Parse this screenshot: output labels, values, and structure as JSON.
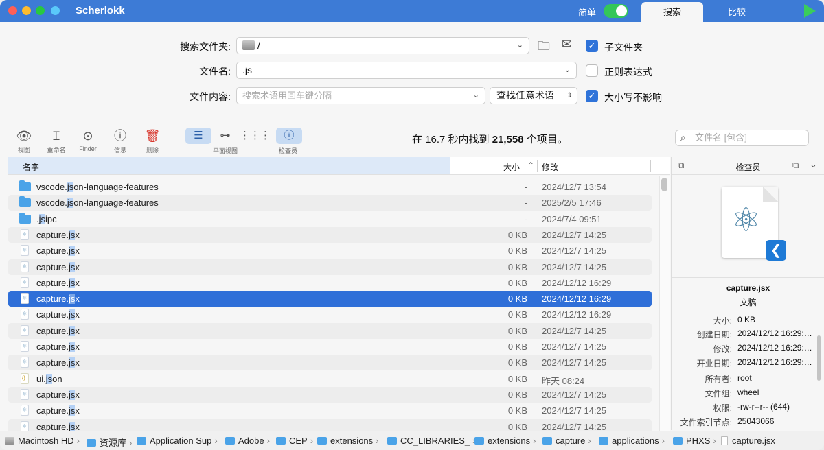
{
  "app": {
    "title": "Scherlokk"
  },
  "titlebar": {
    "simple_label": "简单",
    "tabs": [
      "搜索",
      "比较"
    ]
  },
  "form": {
    "folder_label": "搜索文件夹:",
    "folder_value": "/",
    "name_label": "文件名:",
    "name_value": ".js",
    "content_label": "文件内容:",
    "content_placeholder": "搜索术语用回车键分隔",
    "match_mode": "查找任意术语",
    "subfolders_label": "子文件夹",
    "subfolders_checked": true,
    "regex_label": "正则表达式",
    "regex_checked": false,
    "case_label": "大小写不影响",
    "case_checked": true
  },
  "toolbar": {
    "buttons": [
      {
        "label": "视图",
        "icon": "eye-icon"
      },
      {
        "label": "重命名",
        "icon": "rename-icon"
      },
      {
        "label": "Finder",
        "icon": "location-pin-icon"
      },
      {
        "label": "信息",
        "icon": "info-icon"
      },
      {
        "label": "删除",
        "icon": "trash-icon"
      }
    ],
    "flat_view_label": "平面视图",
    "inspector_label": "检查员",
    "status_prefix": "在 16.7 秒内找到 ",
    "status_count": "21,558",
    "status_suffix": " 个项目。",
    "search_placeholder": "文件名 [包含]"
  },
  "table": {
    "columns": {
      "name": "名字",
      "size": "大小",
      "modified": "修改"
    },
    "rows": [
      {
        "icon": "folder",
        "pre": "vscode.",
        "hl": "js",
        "post": "on-language-features",
        "size": "-",
        "date": "2024/12/7 13:54"
      },
      {
        "icon": "folder",
        "pre": "vscode.",
        "hl": "js",
        "post": "on-language-features",
        "size": "-",
        "date": "2025/2/5 17:46"
      },
      {
        "icon": "folder",
        "pre": ".",
        "hl": "js",
        "post": "ipc",
        "size": "-",
        "date": "2024/7/4 09:51"
      },
      {
        "icon": "file",
        "pre": "capture.",
        "hl": "js",
        "post": "x",
        "size": "0 KB",
        "date": "2024/12/7 14:25"
      },
      {
        "icon": "file",
        "pre": "capture.",
        "hl": "js",
        "post": "x",
        "size": "0 KB",
        "date": "2024/12/7 14:25"
      },
      {
        "icon": "file",
        "pre": "capture.",
        "hl": "js",
        "post": "x",
        "size": "0 KB",
        "date": "2024/12/7 14:25"
      },
      {
        "icon": "file",
        "pre": "capture.",
        "hl": "js",
        "post": "x",
        "size": "0 KB",
        "date": "2024/12/12 16:29"
      },
      {
        "icon": "file",
        "pre": "capture.",
        "hl": "js",
        "post": "x",
        "size": "0 KB",
        "date": "2024/12/12 16:29",
        "selected": true
      },
      {
        "icon": "file",
        "pre": "capture.",
        "hl": "js",
        "post": "x",
        "size": "0 KB",
        "date": "2024/12/12 16:29"
      },
      {
        "icon": "file",
        "pre": "capture.",
        "hl": "js",
        "post": "x",
        "size": "0 KB",
        "date": "2024/12/7 14:25"
      },
      {
        "icon": "file",
        "pre": "capture.",
        "hl": "js",
        "post": "x",
        "size": "0 KB",
        "date": "2024/12/7 14:25"
      },
      {
        "icon": "file",
        "pre": "capture.",
        "hl": "js",
        "post": "x",
        "size": "0 KB",
        "date": "2024/12/7 14:25"
      },
      {
        "icon": "json",
        "pre": "ui.",
        "hl": "js",
        "post": "on",
        "size": "0 KB",
        "date": "昨天 08:24"
      },
      {
        "icon": "file",
        "pre": "capture.",
        "hl": "js",
        "post": "x",
        "size": "0 KB",
        "date": "2024/12/7 14:25"
      },
      {
        "icon": "file",
        "pre": "capture.",
        "hl": "js",
        "post": "x",
        "size": "0 KB",
        "date": "2024/12/7 14:25"
      },
      {
        "icon": "file",
        "pre": "capture.",
        "hl": "js",
        "post": "x",
        "size": "0 KB",
        "date": "2024/12/7 14:25"
      }
    ]
  },
  "inspector": {
    "title": "检查员",
    "file_name": "capture.jsx",
    "kind": "文稿",
    "props": [
      {
        "k": "大小:",
        "v": "0 KB"
      },
      {
        "k": "创建日期:",
        "v": "2024/12/12 16:29:…"
      },
      {
        "k": "修改:",
        "v": "2024/12/12 16:29:…"
      },
      {
        "k": "开业日期:",
        "v": "2024/12/12 16:29:…"
      },
      {
        "k": "所有者:",
        "v": "root"
      },
      {
        "k": "文件组:",
        "v": "wheel"
      },
      {
        "k": "权限:",
        "v": "-rw-r--r-- (644)"
      },
      {
        "k": "文件索引节点:",
        "v": "25043066"
      }
    ]
  },
  "pathbar": [
    {
      "icon": "disk",
      "label": "Macintosh HD"
    },
    {
      "icon": "folder",
      "label": "资源库"
    },
    {
      "icon": "folder",
      "label": "Application Sup"
    },
    {
      "icon": "folder",
      "label": "Adobe"
    },
    {
      "icon": "folder",
      "label": "CEP"
    },
    {
      "icon": "folder",
      "label": "extensions"
    },
    {
      "icon": "folder",
      "label": "CC_LIBRARIES_"
    },
    {
      "icon": "folder",
      "label": "extensions"
    },
    {
      "icon": "folder",
      "label": "capture"
    },
    {
      "icon": "folder",
      "label": "applications"
    },
    {
      "icon": "folder",
      "label": "PHXS"
    },
    {
      "icon": "file",
      "label": "capture.jsx"
    }
  ],
  "colors": {
    "titlebar": "#3d7bd6",
    "accent": "#2f6fd8",
    "highlight": "#b5d1f5",
    "delete": "#d8362c"
  }
}
